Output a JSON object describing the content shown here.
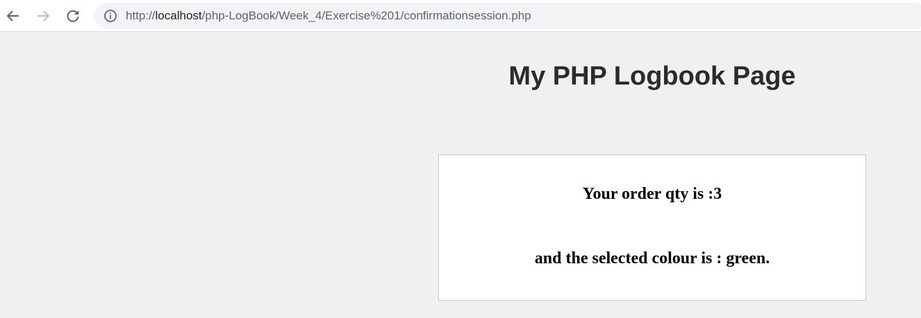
{
  "browser": {
    "url_scheme": "http://",
    "url_host": "localhost",
    "url_path": "/php-LogBook/Week_4/Exercise%201/confirmationsession.php",
    "icons": {
      "back": "arrow-left-icon",
      "forward": "arrow-right-icon",
      "reload": "reload-icon",
      "site_info": "info-icon"
    }
  },
  "page": {
    "title": "My PHP Logbook Page",
    "order_message": "Your order qty is :3",
    "colour_message": "and the selected colour is : green."
  },
  "colors": {
    "page_background": "#f0f0f0",
    "panel_background": "#ffffff",
    "panel_border": "#c8c8c8",
    "title_text": "#2b2b2b"
  }
}
